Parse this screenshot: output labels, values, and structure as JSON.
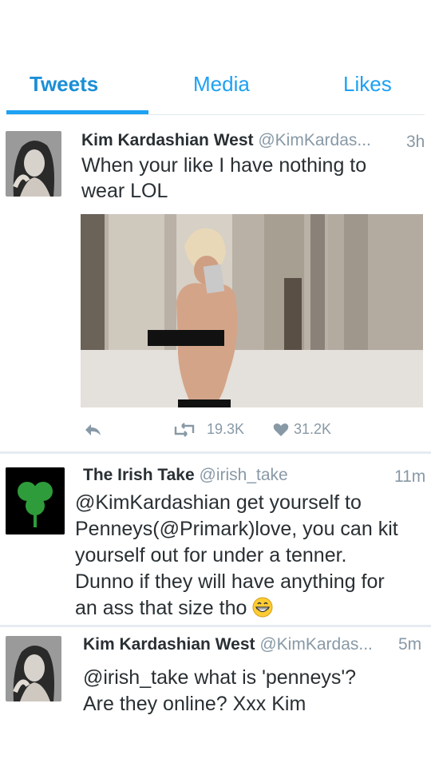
{
  "tabs": [
    {
      "label": "Tweets"
    },
    {
      "label": "Media"
    },
    {
      "label": "Likes"
    }
  ],
  "tweets": [
    {
      "name": "Kim Kardashian West",
      "handle": "@KimKardas...",
      "time": "3h",
      "lines": [
        "When your like I have nothing to",
        "wear LOL"
      ],
      "retweets": "19.3K",
      "likes": "31.2K"
    },
    {
      "name": "The Irish Take",
      "handle": "@irish_take",
      "time": "11m",
      "avatar_logo": "The Irish Take",
      "lines": [
        "@KimKardashian get yourself to",
        "Penneys(@Primark)love, you can kit",
        "yourself out for under a tenner.",
        "Dunno if they will have anything for",
        "an ass that size tho"
      ],
      "emoji": "grinning-face"
    },
    {
      "name": "Kim Kardashian West",
      "handle": "@KimKardas...",
      "time": "5m",
      "lines": [
        "@irish_take what is 'penneys'?",
        "Are they online? Xxx Kim"
      ]
    }
  ],
  "colors": {
    "accent": "#1da1f2",
    "text": "#292f33",
    "muted": "#8899a6"
  }
}
